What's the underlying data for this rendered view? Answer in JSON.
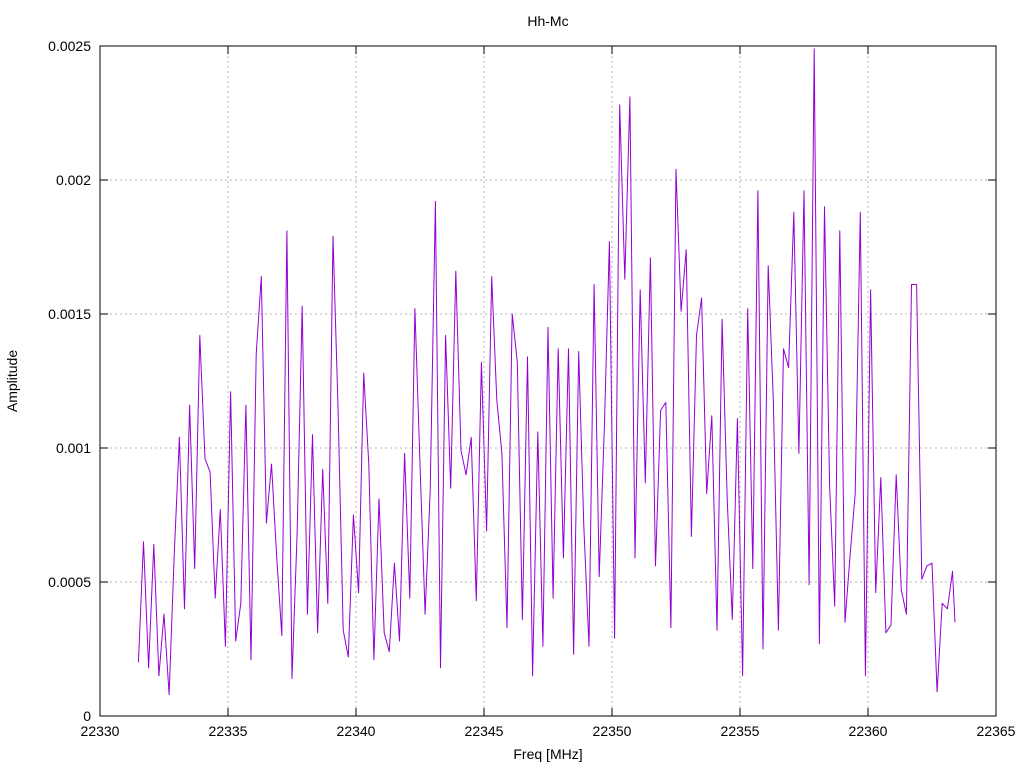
{
  "chart_data": {
    "type": "line",
    "title": "Hh-Mc",
    "xlabel": "Freq [MHz]",
    "ylabel": "Amplitude",
    "xlim": [
      22330,
      22365
    ],
    "ylim": [
      0,
      0.0025
    ],
    "xticks": [
      22330,
      22335,
      22340,
      22345,
      22350,
      22355,
      22360,
      22365
    ],
    "xtick_labels": [
      "22330",
      "22335",
      "22340",
      "22345",
      "22350",
      "22355",
      "22360",
      "22365"
    ],
    "yticks": [
      0,
      0.0005,
      0.001,
      0.0015,
      0.002,
      0.0025
    ],
    "ytick_labels": [
      "0",
      "0.0005",
      "0.001",
      "0.0015",
      "0.002",
      "0.0025"
    ],
    "grid": true,
    "line_color": "#9400d3",
    "series": [
      {
        "x": [
          22331.5,
          22331.7,
          22331.9,
          22332.1,
          22332.3,
          22332.5,
          22332.7,
          22332.9,
          22333.1,
          22333.3,
          22333.5,
          22333.7,
          22333.9,
          22334.1,
          22334.3,
          22334.5,
          22334.7,
          22334.9,
          22335.1,
          22335.3,
          22335.5,
          22335.7,
          22335.9,
          22336.1,
          22336.3,
          22336.5,
          22336.7,
          22336.9,
          22337.1,
          22337.3,
          22337.5,
          22337.7,
          22337.9,
          22338.1,
          22338.3,
          22338.5,
          22338.7,
          22338.9,
          22339.1,
          22339.3,
          22339.5,
          22339.7,
          22339.9,
          22340.1,
          22340.3,
          22340.5,
          22340.7,
          22340.9,
          22341.1,
          22341.3,
          22341.5,
          22341.7,
          22341.9,
          22342.1,
          22342.3,
          22342.5,
          22342.7,
          22342.9,
          22343.1,
          22343.3,
          22343.5,
          22343.7,
          22343.9,
          22344.1,
          22344.3,
          22344.5,
          22344.7,
          22344.9,
          22345.1,
          22345.3,
          22345.5,
          22345.7,
          22345.9,
          22346.1,
          22346.3,
          22346.5,
          22346.7,
          22346.9,
          22347.1,
          22347.3,
          22347.5,
          22347.7,
          22347.9,
          22348.1,
          22348.3,
          22348.5,
          22348.7,
          22348.9,
          22349.1,
          22349.3,
          22349.5,
          22349.7,
          22349.9,
          22350.1,
          22350.3,
          22350.5,
          22350.7,
          22350.9,
          22351.1,
          22351.3,
          22351.5,
          22351.7,
          22351.9,
          22352.1,
          22352.3,
          22352.5,
          22352.7,
          22352.9,
          22353.1,
          22353.3,
          22353.5,
          22353.7,
          22353.9,
          22354.1,
          22354.3,
          22354.5,
          22354.7,
          22354.9,
          22355.1,
          22355.3,
          22355.5,
          22355.7,
          22355.9,
          22356.1,
          22356.3,
          22356.5,
          22356.7,
          22356.9,
          22357.1,
          22357.3,
          22357.5,
          22357.7,
          22357.9,
          22358.1,
          22358.3,
          22358.5,
          22358.7,
          22358.9,
          22359.1,
          22359.3,
          22359.5,
          22359.7,
          22359.9,
          22360.1,
          22360.3,
          22360.5,
          22360.7,
          22360.9,
          22361.1,
          22361.3,
          22361.5,
          22361.7,
          22361.9,
          22362.1,
          22362.3,
          22362.5,
          22362.7,
          22362.9,
          22363.1,
          22363.3,
          22363.4
        ],
        "y": [
          0.0002,
          0.00065,
          0.00018,
          0.00064,
          0.00015,
          0.00038,
          8e-05,
          0.0006,
          0.00104,
          0.0004,
          0.00116,
          0.00055,
          0.00142,
          0.00096,
          0.00091,
          0.00044,
          0.00077,
          0.00026,
          0.00121,
          0.00028,
          0.00042,
          0.00116,
          0.00021,
          0.00135,
          0.00164,
          0.00072,
          0.00094,
          0.0006,
          0.0003,
          0.00181,
          0.00014,
          0.00068,
          0.00153,
          0.00038,
          0.00105,
          0.00031,
          0.00092,
          0.00042,
          0.00179,
          0.00114,
          0.00032,
          0.00022,
          0.00075,
          0.00046,
          0.00128,
          0.00094,
          0.00021,
          0.00081,
          0.00031,
          0.00024,
          0.00057,
          0.00028,
          0.00098,
          0.00044,
          0.00152,
          0.00094,
          0.00038,
          0.00084,
          0.00192,
          0.00018,
          0.00142,
          0.00085,
          0.00166,
          0.00099,
          0.0009,
          0.00104,
          0.00043,
          0.00132,
          0.00069,
          0.00164,
          0.00118,
          0.00098,
          0.00033,
          0.0015,
          0.00132,
          0.00036,
          0.00134,
          0.00015,
          0.00106,
          0.00026,
          0.00145,
          0.00044,
          0.00137,
          0.00059,
          0.00137,
          0.00023,
          0.00136,
          0.00071,
          0.00026,
          0.00161,
          0.00052,
          0.00107,
          0.00177,
          0.00029,
          0.00228,
          0.00163,
          0.00231,
          0.00059,
          0.00159,
          0.00087,
          0.00171,
          0.00056,
          0.00114,
          0.00117,
          0.00033,
          0.00204,
          0.00151,
          0.00174,
          0.00067,
          0.00142,
          0.00156,
          0.00083,
          0.00112,
          0.00032,
          0.00148,
          0.00081,
          0.00036,
          0.00111,
          0.00015,
          0.00152,
          0.00055,
          0.00196,
          0.00025,
          0.00168,
          0.00118,
          0.00032,
          0.00137,
          0.0013,
          0.00188,
          0.00098,
          0.00196,
          0.00049,
          0.00249,
          0.00027,
          0.0019,
          0.00086,
          0.00041,
          0.00181,
          0.00035,
          0.0006,
          0.00083,
          0.00188,
          0.00015,
          0.00159,
          0.00046,
          0.00089,
          0.00031,
          0.00034,
          0.0009,
          0.00047,
          0.00038,
          0.00161,
          0.00161,
          0.00051,
          0.00056,
          0.00057,
          9e-05,
          0.00042,
          0.0004,
          0.00054,
          0.00035
        ]
      }
    ]
  }
}
